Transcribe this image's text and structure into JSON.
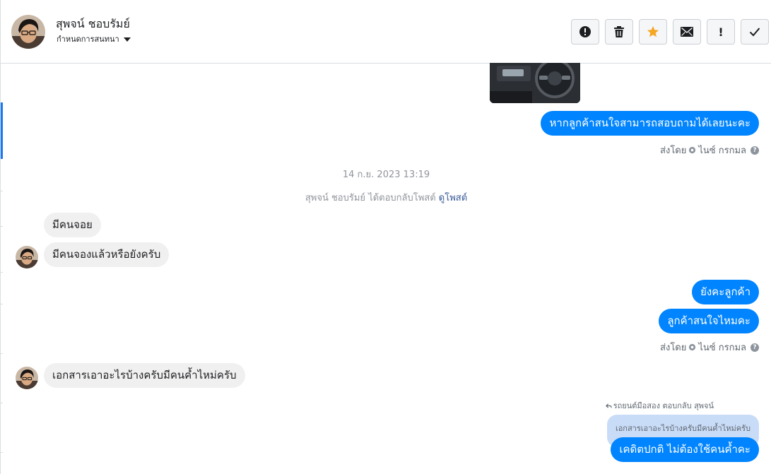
{
  "header": {
    "name": "สุพจน์ ชอบรัมย์",
    "subtitle": "กำหนดการสนทนา"
  },
  "actions": [
    {
      "name": "report-icon"
    },
    {
      "name": "trash-icon"
    },
    {
      "name": "star-icon",
      "color": "#f5a623"
    },
    {
      "name": "mail-icon"
    },
    {
      "name": "important-icon",
      "label": "!"
    },
    {
      "name": "check-icon"
    }
  ],
  "messages": {
    "out1": "หากลูกค้าสนใจสามารถสอบถามได้เลยนะคะ",
    "sent_by_1": {
      "prefix": "ส่งโดย",
      "name": "ไนซ์ กรกมล",
      "help": "?"
    },
    "timestamp": "14 ก.ย. 2023 13:19",
    "system_note": {
      "text": "สุพจน์ ชอบรัมย์ ได้ตอบกลับโพสต์",
      "link": "ดูโพสต์"
    },
    "in1": "มีคนจอย",
    "in2": "มีคนจองแล้วหรือยังครับ",
    "out2": "ยังคะลูกค้า",
    "out3": "ลูกค้าสนใจไหมคะ",
    "sent_by_2": {
      "prefix": "ส่งโดย",
      "name": "ไนซ์ กรกมล",
      "help": "?"
    },
    "in3": "เอกสารเอาอะไรบ้างครับมีคนค้ำไหม่ครับ",
    "reply_note": "รถยนต์มือสอง ตอบกลับ สุพจน์",
    "quoted": "เอกสารเอาอะไรบ้างครับมีคนค้ำไหม่ครับ",
    "out4": "เคดิตปกติ ไม่ต้องใช้คนค้ำคะ"
  },
  "colors": {
    "outgoing": "#0084ff",
    "incoming": "#f1f0f0",
    "accent": "#1877f2"
  }
}
